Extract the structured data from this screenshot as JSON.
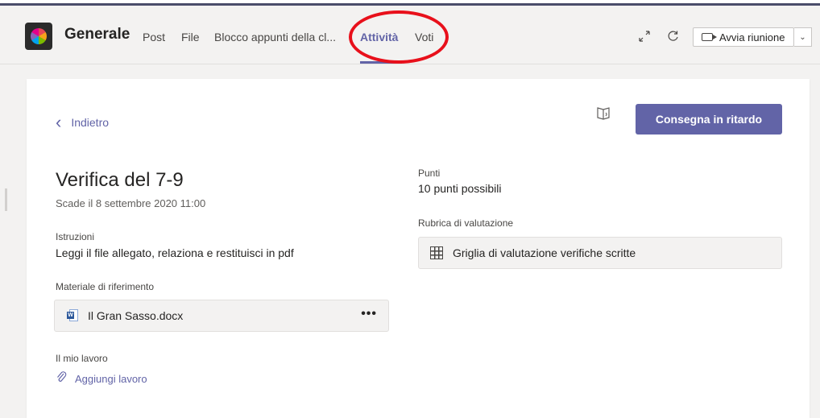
{
  "header": {
    "channel_name": "Generale",
    "tabs": [
      {
        "label": "Post"
      },
      {
        "label": "File"
      },
      {
        "label": "Blocco appunti della cl..."
      },
      {
        "label": "Attività",
        "active": true
      },
      {
        "label": "Voti"
      }
    ],
    "expand_icon": "expand-icon",
    "refresh_icon": "refresh-icon",
    "meet_button": "Avvia riunione",
    "accent_color": "#6264a7",
    "highlight_color": "#e8101b"
  },
  "assignment": {
    "back_label": "Indietro",
    "submit_label": "Consegna in ritardo",
    "title": "Verifica del 7-9",
    "due": "Scade il 8 settembre 2020 11:00",
    "instructions_label": "Istruzioni",
    "instructions": "Leggi il file allegato, relaziona e restituisci in pdf",
    "reference_label": "Materiale di riferimento",
    "reference_file": "Il Gran Sasso.docx",
    "my_work_label": "Il mio lavoro",
    "add_work_label": "Aggiungi lavoro",
    "points_label": "Punti",
    "points_value": "10 punti possibili",
    "rubric_label": "Rubrica di valutazione",
    "rubric_name": "Griglia di valutazione verifiche scritte"
  }
}
